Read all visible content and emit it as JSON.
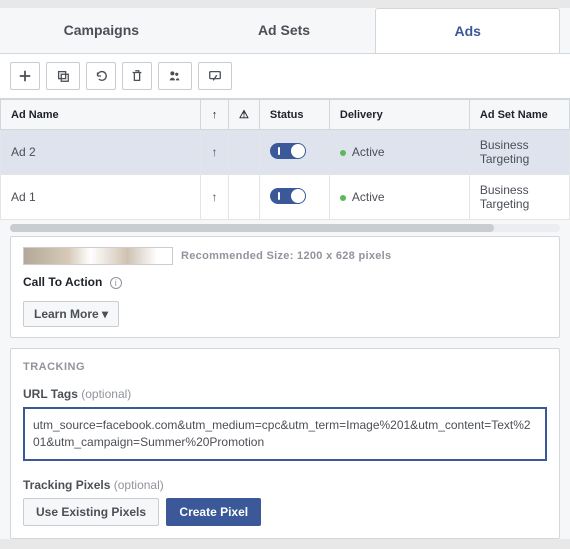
{
  "tabs": {
    "campaigns": "Campaigns",
    "adsets": "Ad Sets",
    "ads": "Ads"
  },
  "table": {
    "headers": {
      "name": "Ad Name",
      "arrow": "↑",
      "warn": "⚠",
      "status": "Status",
      "delivery": "Delivery",
      "adset": "Ad Set Name"
    },
    "rows": [
      {
        "name": "Ad 2",
        "delivery": "Active",
        "adset": "Business Targeting"
      },
      {
        "name": "Ad 1",
        "delivery": "Active",
        "adset": "Business Targeting"
      }
    ]
  },
  "editor": {
    "recommended": "Recommended Size: 1200 x 628 pixels",
    "cta_label": "Call To Action",
    "cta_value": "Learn More ▾"
  },
  "tracking": {
    "header": "TRACKING",
    "url_tags_label": "URL Tags",
    "optional": "(optional)",
    "url_tags_value": "utm_source=facebook.com&utm_medium=cpc&utm_term=Image%201&utm_content=Text%201&utm_campaign=Summer%20Promotion",
    "pixels_label": "Tracking Pixels",
    "use_existing": "Use Existing Pixels",
    "create_pixel": "Create Pixel"
  }
}
